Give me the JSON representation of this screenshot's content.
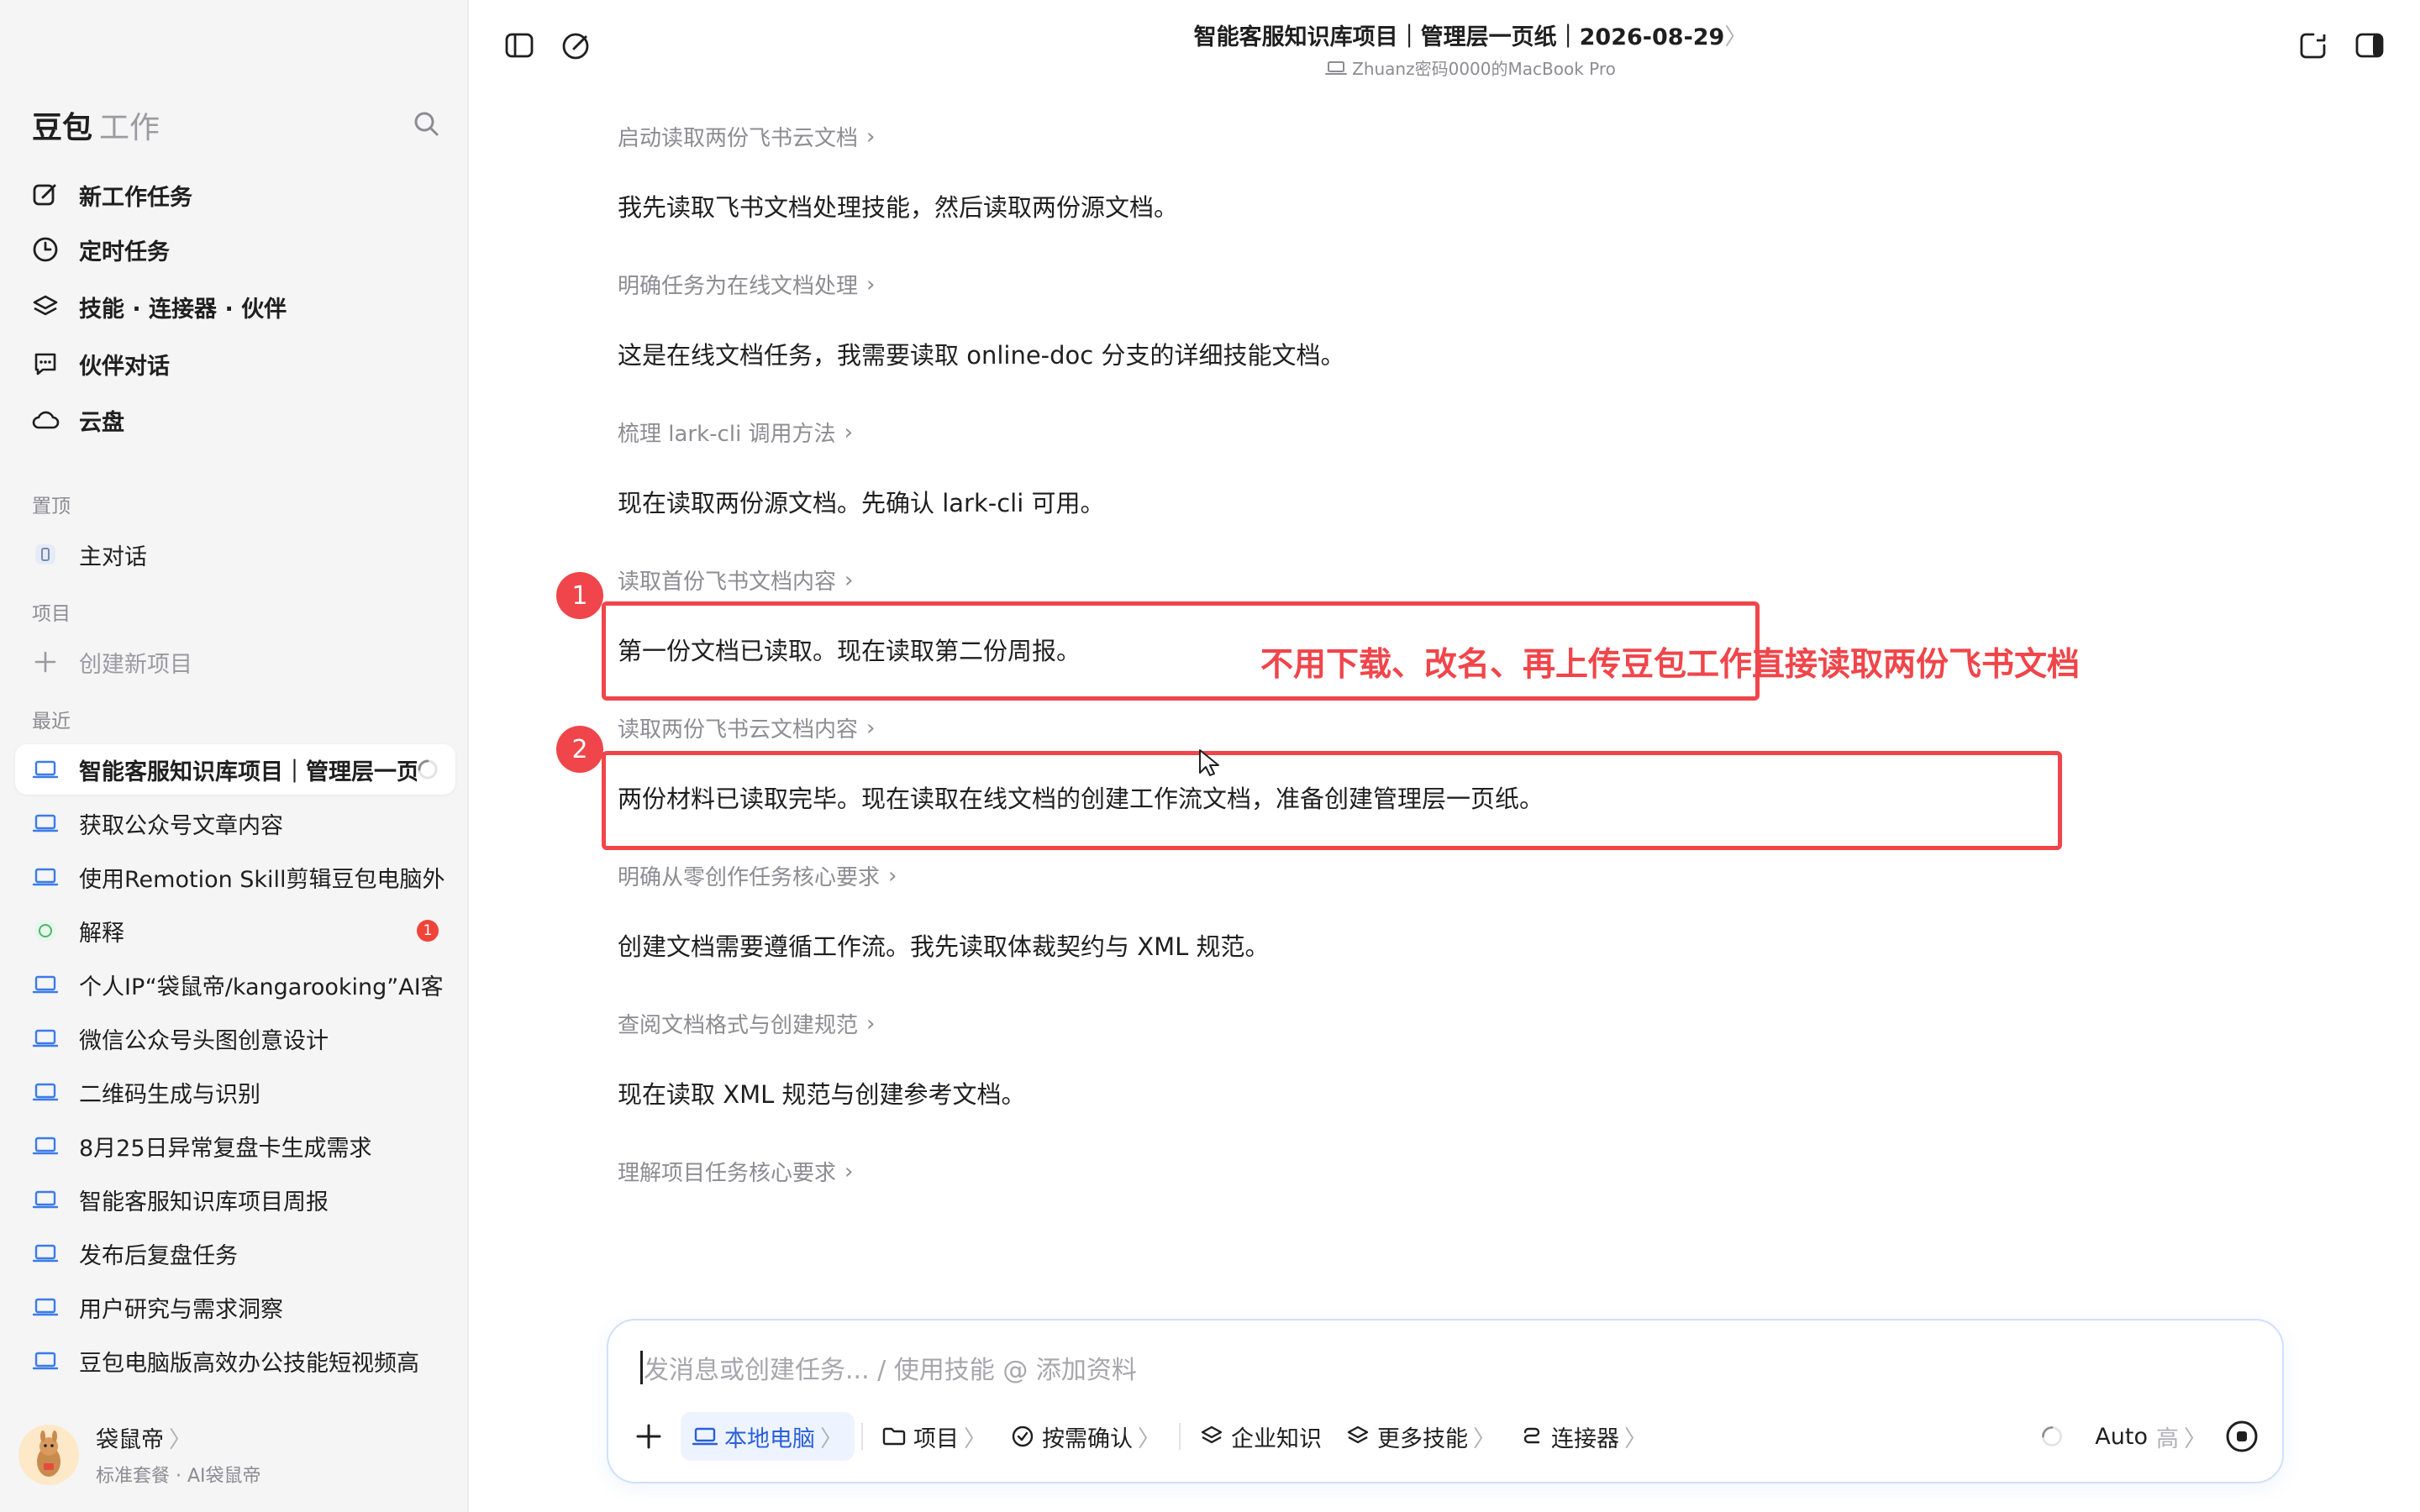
{
  "sidebar": {
    "brand_main": "豆包",
    "brand_sub": "工作",
    "nav": [
      {
        "label": "新工作任务",
        "icon": "edit-icon"
      },
      {
        "label": "定时任务",
        "icon": "clock-icon"
      },
      {
        "label": "技能 · 连接器 · 伙伴",
        "icon": "layers-icon"
      },
      {
        "label": "伙伴对话",
        "icon": "chat-bubble-icon"
      },
      {
        "label": "云盘",
        "icon": "cloud-icon"
      }
    ],
    "section_pinned": "置顶",
    "pinned": [
      {
        "label": "主对话"
      }
    ],
    "section_projects": "项目",
    "create_project": "创建新项目",
    "section_recent": "最近",
    "recent": [
      {
        "label": "智能客服知识库项目｜管理层一页纸"
      },
      {
        "label": "获取公众号文章内容"
      },
      {
        "label": "使用Remotion Skill剪辑豆包电脑外"
      },
      {
        "label": "解释",
        "badge": "1"
      },
      {
        "label": "个人IP“袋鼠帝/kangarooking”AI客"
      },
      {
        "label": "微信公众号头图创意设计"
      },
      {
        "label": "二维码生成与识别"
      },
      {
        "label": "8月25日异常复盘卡生成需求"
      },
      {
        "label": "智能客服知识库项目周报"
      },
      {
        "label": "发布后复盘任务"
      },
      {
        "label": "用户研究与需求洞察"
      },
      {
        "label": "豆包电脑版高效办公技能短视频高"
      }
    ],
    "profile": {
      "name": "袋鼠帝",
      "name_chevron": "〉",
      "sub": "标准套餐 · AI袋鼠帝"
    }
  },
  "header": {
    "title": "智能客服知识库项目｜管理层一页纸｜2026-08-29",
    "title_chevron": "〉",
    "device": "Zhuanz密码0000的MacBook Pro"
  },
  "chat": {
    "steps": [
      {
        "label": "启动读取两份飞书云文档",
        "message": "我先读取飞书文档处理技能，然后读取两份源文档。"
      },
      {
        "label": "明确任务为在线文档处理",
        "message": "这是在线文档任务，我需要读取 online-doc 分支的详细技能文档。"
      },
      {
        "label": "梳理 lark-cli 调用方法",
        "message": "现在读取两份源文档。先确认 lark-cli 可用。"
      },
      {
        "label": "读取首份飞书文档内容",
        "message": "第一份文档已读取。现在读取第二份周报。"
      },
      {
        "label": "读取两份飞书云文档内容",
        "message": "两份材料已读取完毕。现在读取在线文档的创建工作流文档，准备创建管理层一页纸。"
      },
      {
        "label": "明确从零创作任务核心要求",
        "message": "创建文档需要遵循工作流。我先读取体裁契约与 XML 规范。"
      },
      {
        "label": "查阅文档格式与创建规范",
        "message": "现在读取 XML 规范与创建参考文档。"
      },
      {
        "label": "理解项目任务核心要求",
        "message": ""
      }
    ],
    "step_arrow": "›"
  },
  "annotation": {
    "num1": "1",
    "num2": "2",
    "text": "不用下载、改名、再上传豆包工作直接读取两份飞书文档",
    "color": "#f0454a"
  },
  "composer": {
    "placeholder": "发消息或创建任务... / 使用技能 @ 添加资料",
    "tools": [
      {
        "label": "本地电脑",
        "chevron": "〉"
      },
      {
        "label": "项目",
        "chevron": "〉"
      },
      {
        "label": "按需确认",
        "chevron": "〉"
      },
      {
        "label": "企业知识",
        "chevron": ""
      },
      {
        "label": "更多技能",
        "chevron": "〉"
      },
      {
        "label": "连接器",
        "chevron": "〉"
      }
    ],
    "model": "Auto",
    "model_level": "高",
    "model_chevron": "〉"
  },
  "colors": {
    "accent": "#2a5fd8",
    "annotation": "#f0454a",
    "sidebar_bg": "#f5f5f6"
  }
}
